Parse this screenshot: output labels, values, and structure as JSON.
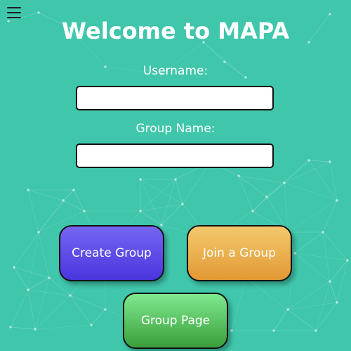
{
  "header": {
    "title": "Welcome to MAPA",
    "menu_icon": "hamburger-menu-icon"
  },
  "form": {
    "username_label": "Username:",
    "username_value": "",
    "group_name_label": "Group Name:",
    "group_name_value": ""
  },
  "actions": {
    "create_group": "Create Group",
    "join_group": "Join a Group",
    "group_page": "Group Page"
  },
  "colors": {
    "background": "#3fc6ab",
    "create_button": "#5a48e6",
    "join_button": "#eaad4c",
    "group_page_button": "#55c25f"
  }
}
